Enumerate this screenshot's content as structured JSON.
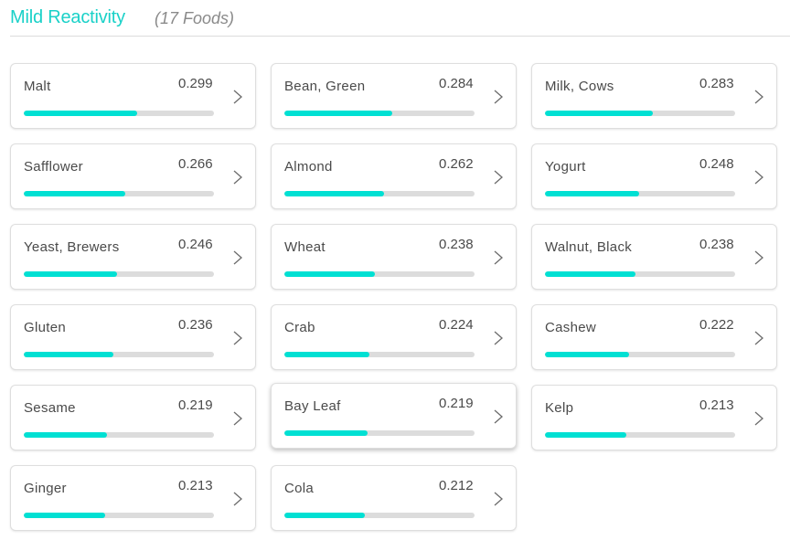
{
  "header": {
    "title": "Mild Reactivity",
    "count_label": "(17 Foods)"
  },
  "colors": {
    "accent": "#1ad1c8",
    "bar_fill": "#00e0d3",
    "bar_track": "#dcdcdc",
    "text": "#4a4a4a",
    "muted": "#8a8a8a"
  },
  "scale_max": 0.5,
  "hovered_index": 13,
  "foods": [
    {
      "name": "Malt",
      "value": "0.299",
      "icon": "chevron-right-icon"
    },
    {
      "name": "Bean, Green",
      "value": "0.284",
      "icon": "chevron-right-icon"
    },
    {
      "name": "Milk, Cows",
      "value": "0.283",
      "icon": "chevron-right-icon"
    },
    {
      "name": "Safflower",
      "value": "0.266",
      "icon": "chevron-right-icon"
    },
    {
      "name": "Almond",
      "value": "0.262",
      "icon": "chevron-right-icon"
    },
    {
      "name": "Yogurt",
      "value": "0.248",
      "icon": "chevron-right-icon"
    },
    {
      "name": "Yeast, Brewers",
      "value": "0.246",
      "icon": "chevron-right-icon"
    },
    {
      "name": "Wheat",
      "value": "0.238",
      "icon": "chevron-right-icon"
    },
    {
      "name": "Walnut, Black",
      "value": "0.238",
      "icon": "chevron-right-icon"
    },
    {
      "name": "Gluten",
      "value": "0.236",
      "icon": "chevron-right-icon"
    },
    {
      "name": "Crab",
      "value": "0.224",
      "icon": "chevron-right-icon"
    },
    {
      "name": "Cashew",
      "value": "0.222",
      "icon": "chevron-right-icon"
    },
    {
      "name": "Sesame",
      "value": "0.219",
      "icon": "chevron-right-icon"
    },
    {
      "name": "Bay Leaf",
      "value": "0.219",
      "icon": "chevron-right-icon"
    },
    {
      "name": "Kelp",
      "value": "0.213",
      "icon": "chevron-right-icon"
    },
    {
      "name": "Ginger",
      "value": "0.213",
      "icon": "chevron-right-icon"
    },
    {
      "name": "Cola",
      "value": "0.212",
      "icon": "chevron-right-icon"
    }
  ]
}
